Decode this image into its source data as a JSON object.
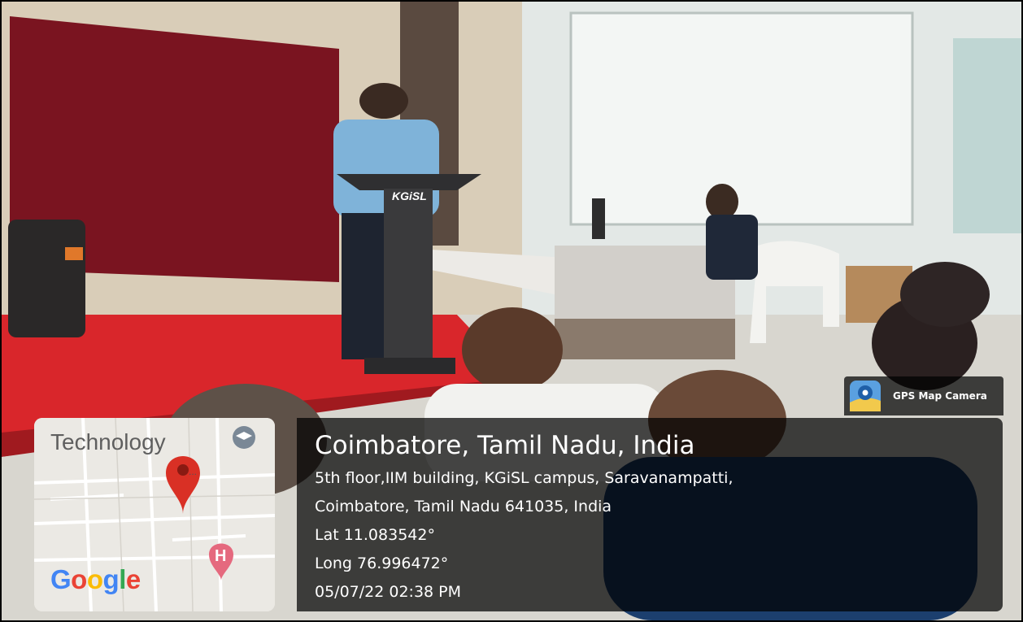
{
  "podium": {
    "brand": "KGiSL"
  },
  "badge": {
    "label": "GPS Map Camera",
    "icon": "map-pin-camera-icon"
  },
  "map": {
    "place_label": "Technology",
    "hospital_partial": "K\nH",
    "brand": "Google",
    "icons": [
      "graduation-cap-icon",
      "location-pin-icon",
      "hospital-icon"
    ]
  },
  "location": {
    "title": "Coimbatore, Tamil Nadu, India",
    "address_line1": "5th floor,IIM building, KGiSL campus, Saravanampatti,",
    "address_line2": "Coimbatore, Tamil Nadu 641035, India",
    "lat": "Lat 11.083542°",
    "long": "Long 76.996472°",
    "datetime": "05/07/22 02:38 PM"
  },
  "colors": {
    "overlay": "#000000",
    "pin_red": "#d93025",
    "google_blue": "#4285F4",
    "google_red": "#EA4335",
    "google_yellow": "#FBBC05",
    "google_green": "#34A853",
    "stage_red": "#d9262b"
  }
}
